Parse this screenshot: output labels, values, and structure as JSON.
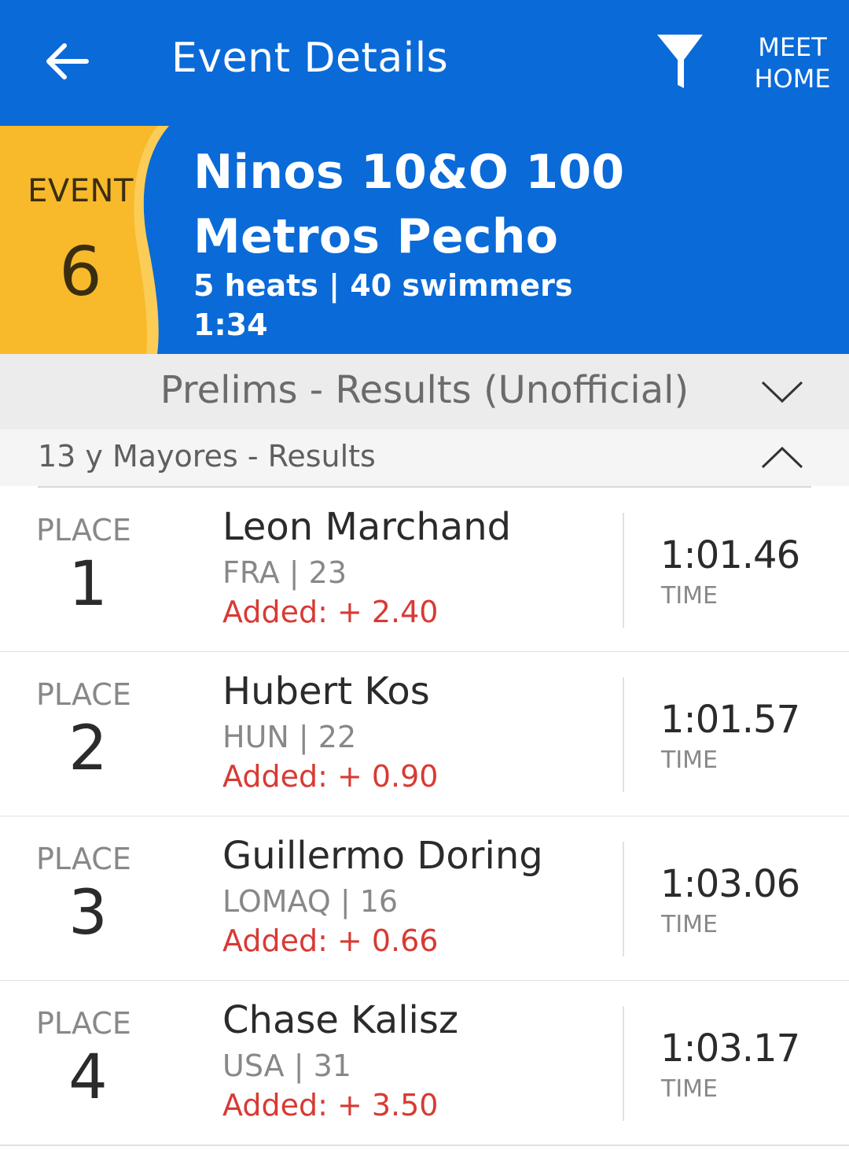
{
  "appbar": {
    "title": "Event Details",
    "meet_home_line1": "MEET",
    "meet_home_line2": "HOME",
    "back_icon": "arrow-left-icon",
    "filter_icon": "filter-funnel-icon"
  },
  "event": {
    "label": "EVENT",
    "number": "6",
    "name": "Ninos 10&O 100 Metros Pecho",
    "summary": "5 heats | 40 swimmers",
    "time": "1:34"
  },
  "session": {
    "title": "Prelims - Results (Unofficial)",
    "icon": "chevron-down-icon"
  },
  "group": {
    "title": "13 y Mayores - Results",
    "icon": "chevron-up-icon"
  },
  "results": [
    {
      "place_label": "PLACE",
      "place": "1",
      "name": "Leon Marchand",
      "info": "FRA | 23",
      "added": "Added: + 2.40",
      "time": "1:01.46",
      "time_label": "TIME"
    },
    {
      "place_label": "PLACE",
      "place": "2",
      "name": "Hubert Kos",
      "info": "HUN | 22",
      "added": "Added: + 0.90",
      "time": "1:01.57",
      "time_label": "TIME"
    },
    {
      "place_label": "PLACE",
      "place": "3",
      "name": "Guillermo Doring",
      "info": "LOMAQ | 16",
      "added": "Added: + 0.66",
      "time": "1:03.06",
      "time_label": "TIME"
    },
    {
      "place_label": "PLACE",
      "place": "4",
      "name": "Chase Kalisz",
      "info": "USA | 31",
      "added": "Added: + 3.50",
      "time": "1:03.17",
      "time_label": "TIME"
    }
  ],
  "colors": {
    "primary_blue": "#0a6ad8",
    "badge_yellow": "#f8b92b",
    "added_red": "#d83a34"
  }
}
